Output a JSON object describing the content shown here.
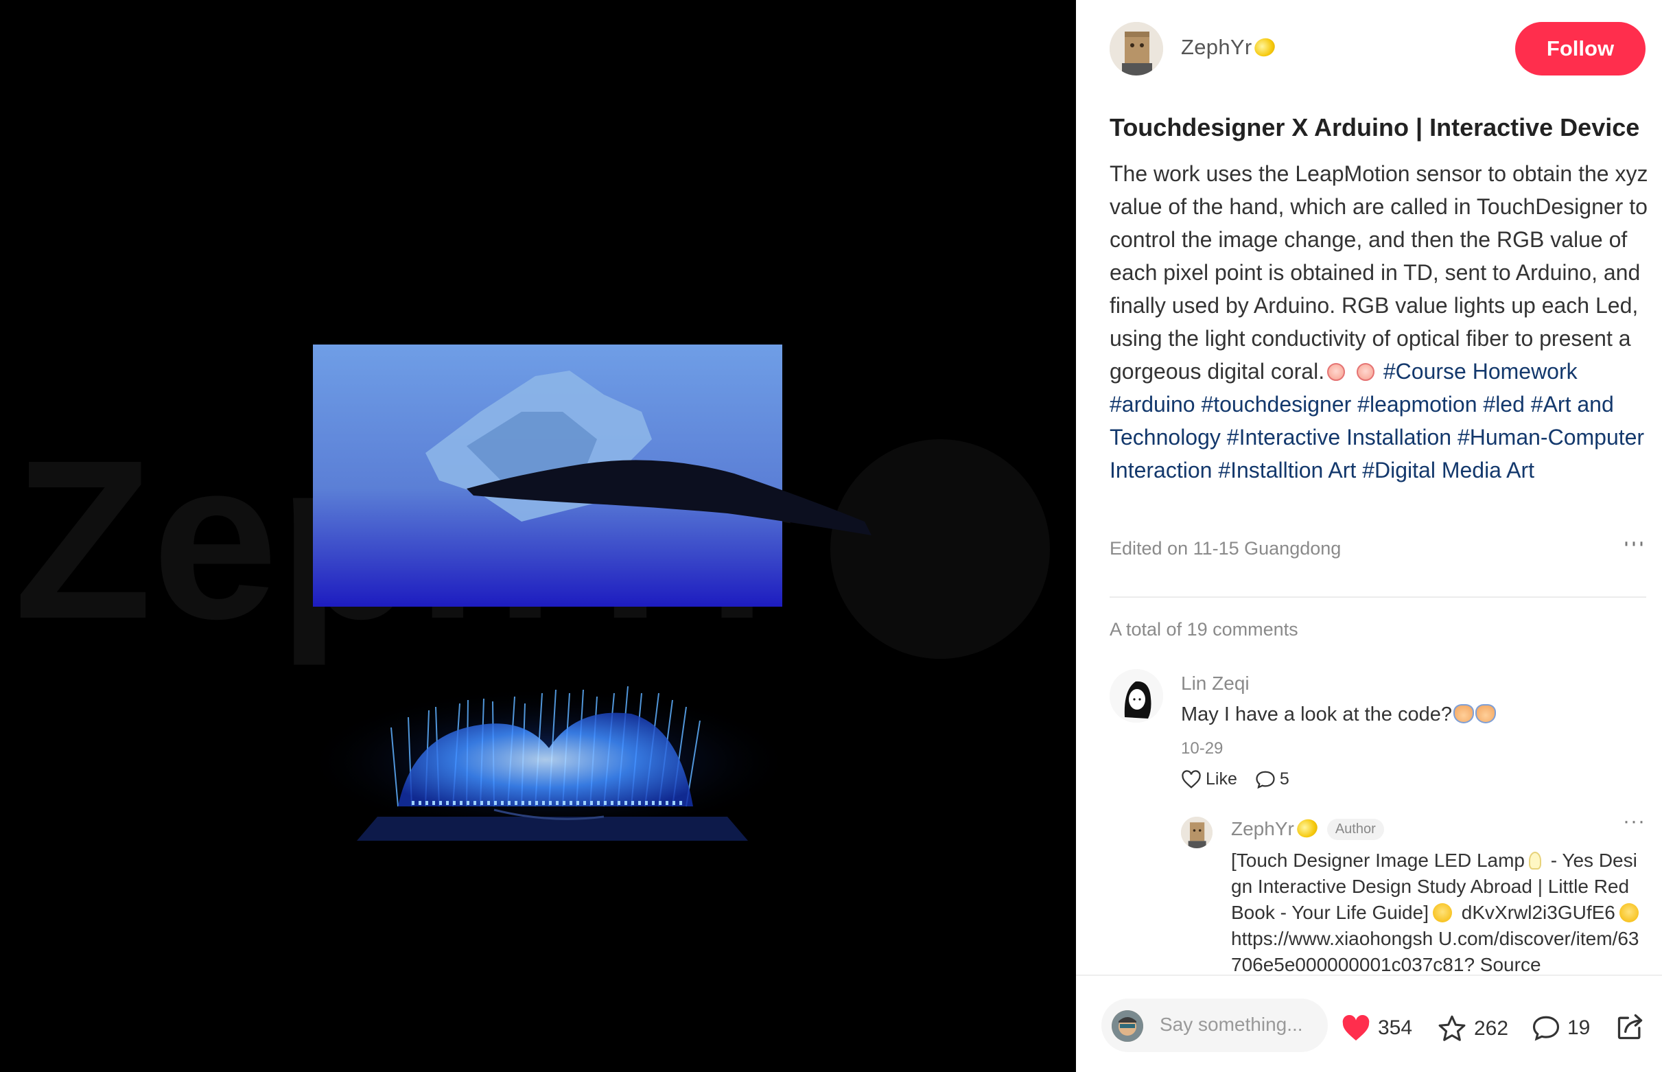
{
  "author": {
    "name": "ZephYr",
    "follow_label": "Follow"
  },
  "post": {
    "title": "Touchdesigner X Arduino | Interactive Device",
    "description": "The work uses the LeapMotion sensor to obtain the xyz value of the hand, which are called in TouchDesigner to control the image change, and then the RGB value of each pixel point is obtained in TD, sent to Arduino, and finally used by Arduino. RGB value lights up each Led, using the light conductivity of optical fiber to present a gorgeous digital coral.",
    "tags": [
      "#Course Homework",
      "#arduino",
      "#touchdesigner",
      "#leapmotion",
      "#led",
      "#Art and Technology",
      "#Interactive Installation",
      "#Human-Computer Interaction",
      "#Installtion Art",
      "#Digital Media Art"
    ],
    "edited": "Edited on 11-15 Guangdong",
    "more": "···"
  },
  "comments": {
    "total_label": "A total of 19 comments",
    "first": {
      "user": "Lin Zeqi",
      "text": "May I have a look at the code?",
      "date": "10-29",
      "like_label": "Like",
      "reply_count": "5",
      "more": "···"
    },
    "reply": {
      "user": "ZephYr",
      "badge": "Author",
      "text_part1": "[Touch Designer Image LED Lamp",
      "text_part2": " - Yes Design Interactive Design Study Abroad | Little Red Book - Your Life Guide]",
      "text_part3": " dKvXrwl2i3GUfE6",
      "text_part4": " https://www.xiaohongsh U.com/discover/item/63706e5e000000001c037c81? Source",
      "more": "···"
    }
  },
  "bottom_bar": {
    "placeholder": "Say something...",
    "likes": "354",
    "stars": "262",
    "comments": "19"
  },
  "media": {
    "watermark": "ZephYr"
  },
  "colors": {
    "follow": "#ff2e4d",
    "tag": "#13386c",
    "heart": "#ff2e4d"
  }
}
